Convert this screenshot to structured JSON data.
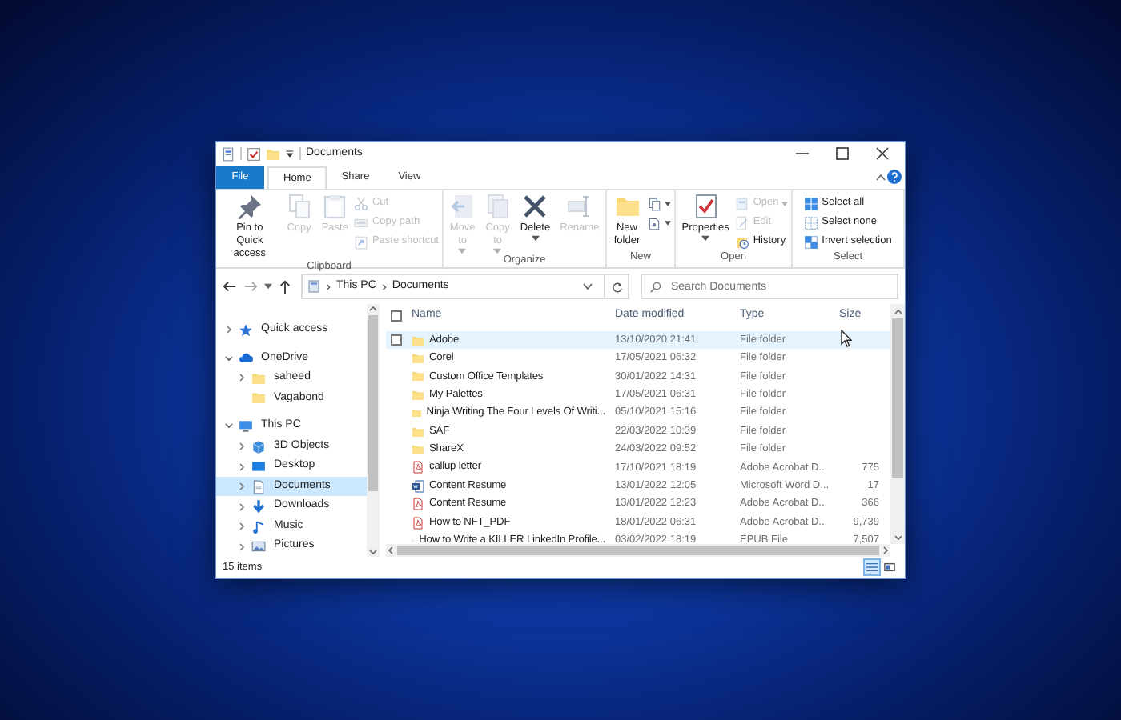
{
  "window": {
    "title": "Documents"
  },
  "ribbon": {
    "tabs": [
      {
        "label": "File",
        "kind": "file",
        "selected": false
      },
      {
        "label": "Home",
        "kind": "tab",
        "selected": true
      },
      {
        "label": "Share",
        "kind": "tab",
        "selected": false
      },
      {
        "label": "View",
        "kind": "tab",
        "selected": false
      }
    ],
    "groups": [
      {
        "label": "Clipboard",
        "commands": [
          {
            "label": "Pin to Quick access",
            "kind": "large",
            "disabled": false,
            "dropdown": false
          },
          {
            "label": "Copy",
            "kind": "large",
            "disabled": true,
            "dropdown": false
          },
          {
            "label": "Paste",
            "kind": "large",
            "disabled": true,
            "dropdown": false
          },
          {
            "label": "Cut",
            "kind": "small",
            "disabled": true,
            "dropdown": false
          },
          {
            "label": "Copy path",
            "kind": "small",
            "disabled": true,
            "dropdown": false
          },
          {
            "label": "Paste shortcut",
            "kind": "small",
            "disabled": true,
            "dropdown": false
          }
        ]
      },
      {
        "label": "Organize",
        "commands": [
          {
            "label": "Move to",
            "kind": "large",
            "disabled": true,
            "dropdown": true
          },
          {
            "label": "Copy to",
            "kind": "large",
            "disabled": true,
            "dropdown": true
          },
          {
            "label": "Delete",
            "kind": "large",
            "disabled": false,
            "dropdown": true
          },
          {
            "label": "Rename",
            "kind": "large",
            "disabled": true,
            "dropdown": false
          }
        ]
      },
      {
        "label": "New",
        "commands": [
          {
            "label": "New folder",
            "kind": "large",
            "disabled": false,
            "dropdown": false
          },
          {
            "kind": "icon",
            "disabled": false,
            "dropdown": true
          },
          {
            "kind": "icon",
            "disabled": false,
            "dropdown": true
          }
        ]
      },
      {
        "label": "Open",
        "commands": [
          {
            "label": "Properties",
            "kind": "large",
            "disabled": false,
            "dropdown": true
          },
          {
            "label": "Open",
            "kind": "small",
            "disabled": true,
            "dropdown": true
          },
          {
            "label": "Edit",
            "kind": "small",
            "disabled": true,
            "dropdown": false
          },
          {
            "label": "History",
            "kind": "small",
            "disabled": false,
            "dropdown": false
          }
        ]
      },
      {
        "label": "Select",
        "commands": [
          {
            "label": "Select all",
            "kind": "small",
            "disabled": false,
            "dropdown": false
          },
          {
            "label": "Select none",
            "kind": "small",
            "disabled": false,
            "dropdown": false
          },
          {
            "label": "Invert selection",
            "kind": "small",
            "disabled": false,
            "dropdown": false
          }
        ]
      }
    ]
  },
  "address_bar": {
    "path": [
      "This PC",
      "Documents"
    ]
  },
  "search": {
    "placeholder": "Search Documents"
  },
  "navigation": [
    {
      "label": "Quick access",
      "kind": "quick",
      "expanded": false,
      "selected": false
    },
    {
      "label": "OneDrive",
      "kind": "cloud",
      "expanded": true,
      "selected": false,
      "children": [
        {
          "label": "saheed",
          "kind": "folder",
          "expanded": false,
          "selected": false
        },
        {
          "label": "Vagabond",
          "kind": "folder",
          "selected": false
        }
      ]
    },
    {
      "label": "This PC",
      "kind": "pc",
      "expanded": true,
      "selected": false,
      "children": [
        {
          "label": "3D Objects",
          "kind": "cube",
          "expanded": false,
          "selected": false
        },
        {
          "label": "Desktop",
          "kind": "desktop",
          "expanded": false,
          "selected": false
        },
        {
          "label": "Documents",
          "kind": "documents",
          "expanded": false,
          "selected": true
        },
        {
          "label": "Downloads",
          "kind": "downloads",
          "expanded": false,
          "selected": false
        },
        {
          "label": "Music",
          "kind": "music",
          "expanded": false,
          "selected": false
        },
        {
          "label": "Pictures",
          "kind": "pictures",
          "expanded": false,
          "selected": false
        }
      ]
    }
  ],
  "table": {
    "header_checkbox": {
      "checked": false
    },
    "columns": [
      "Name",
      "Date modified",
      "Type",
      "Size"
    ],
    "rows": [
      {
        "name": "Adobe",
        "date": "13/10/2020 21:41",
        "type": "File folder",
        "kind": "folder",
        "hovered": true
      },
      {
        "name": "Corel",
        "date": "17/05/2021 06:32",
        "type": "File folder",
        "kind": "folder",
        "hovered": false
      },
      {
        "name": "Custom Office Templates",
        "date": "30/01/2022 14:31",
        "type": "File folder",
        "kind": "folder",
        "hovered": false
      },
      {
        "name": "My Palettes",
        "date": "17/05/2021 06:31",
        "type": "File folder",
        "kind": "folder",
        "hovered": false
      },
      {
        "name": "Ninja Writing The Four Levels Of Writi...",
        "date": "05/10/2021 15:16",
        "type": "File folder",
        "kind": "folder",
        "hovered": false
      },
      {
        "name": "SAF",
        "date": "22/03/2022 10:39",
        "type": "File folder",
        "kind": "folder",
        "hovered": false
      },
      {
        "name": "ShareX",
        "date": "24/03/2022 09:52",
        "type": "File folder",
        "kind": "folder",
        "hovered": false
      },
      {
        "name": "callup letter",
        "date": "17/10/2021 18:19",
        "type": "Adobe Acrobat D...",
        "size": "775",
        "kind": "pdf",
        "hovered": false
      },
      {
        "name": "Content Resume",
        "date": "13/01/2022 12:05",
        "type": "Microsoft Word D...",
        "size": "17",
        "kind": "word",
        "hovered": false
      },
      {
        "name": "Content Resume",
        "date": "13/01/2022 12:23",
        "type": "Adobe Acrobat D...",
        "size": "366",
        "kind": "pdf",
        "hovered": false
      },
      {
        "name": "How to NFT_PDF",
        "date": "18/01/2022 06:31",
        "type": "Adobe Acrobat D...",
        "size": "9,739",
        "kind": "pdf",
        "hovered": false
      },
      {
        "name": "How to Write a KILLER LinkedIn Profile...",
        "date": "03/02/2022 18:19",
        "type": "EPUB File",
        "size": "7,507",
        "kind": "file",
        "hovered": false
      }
    ]
  },
  "status_bar": {
    "text": "15 items",
    "view_buttons": [
      {
        "kind": "details",
        "selected": true
      },
      {
        "kind": "tiles",
        "selected": false
      }
    ]
  }
}
